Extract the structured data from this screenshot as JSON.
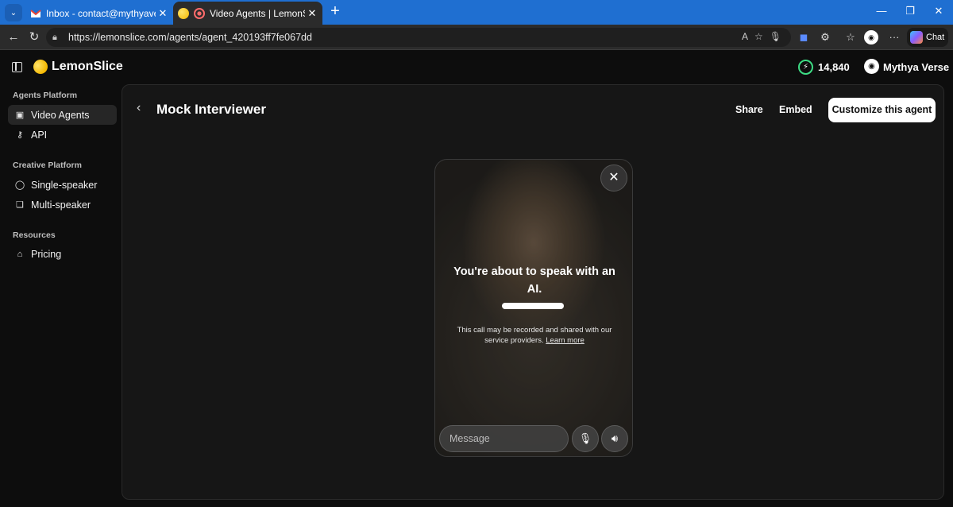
{
  "browser": {
    "tabs": [
      {
        "title": "Inbox - contact@mythyaverse.com",
        "active": false,
        "favicon": "gmail-icon"
      },
      {
        "title": "Video Agents | LemonSlice",
        "active": true,
        "favicon": "lemon-icon"
      }
    ],
    "url": "https://lemonslice.com/agents/agent_420193ff7fe067dd",
    "chat_label": "Chat"
  },
  "app": {
    "brand": "LemonSlice",
    "credits": "14,840",
    "user_name": "Mythya Verse"
  },
  "sidebar": {
    "sections": [
      {
        "label": "Agents Platform",
        "items": [
          {
            "label": "Video Agents",
            "icon": "user-square-icon",
            "active": true
          },
          {
            "label": "API",
            "icon": "key-icon",
            "active": false
          }
        ]
      },
      {
        "label": "Creative Platform",
        "items": [
          {
            "label": "Single-speaker",
            "icon": "speech-bubble-icon",
            "active": false
          },
          {
            "label": "Multi-speaker",
            "icon": "speech-bubbles-icon",
            "active": false
          }
        ]
      },
      {
        "label": "Resources",
        "items": [
          {
            "label": "Pricing",
            "icon": "tag-icon",
            "active": false
          }
        ]
      }
    ]
  },
  "main": {
    "title": "Mock Interviewer",
    "share_label": "Share",
    "embed_label": "Embed",
    "customize_label": "Customize this agent"
  },
  "video_card": {
    "heading": "You're about to speak with an AI.",
    "disclaimer": "This call may be recorded and shared with our service providers.",
    "learn_more": "Learn more",
    "message_placeholder": "Message"
  },
  "colors": {
    "accent_tab_bar": "#1f6fd1",
    "credits_ring": "#3ddc84",
    "background": "#0d0d0d",
    "card": "#161616"
  }
}
